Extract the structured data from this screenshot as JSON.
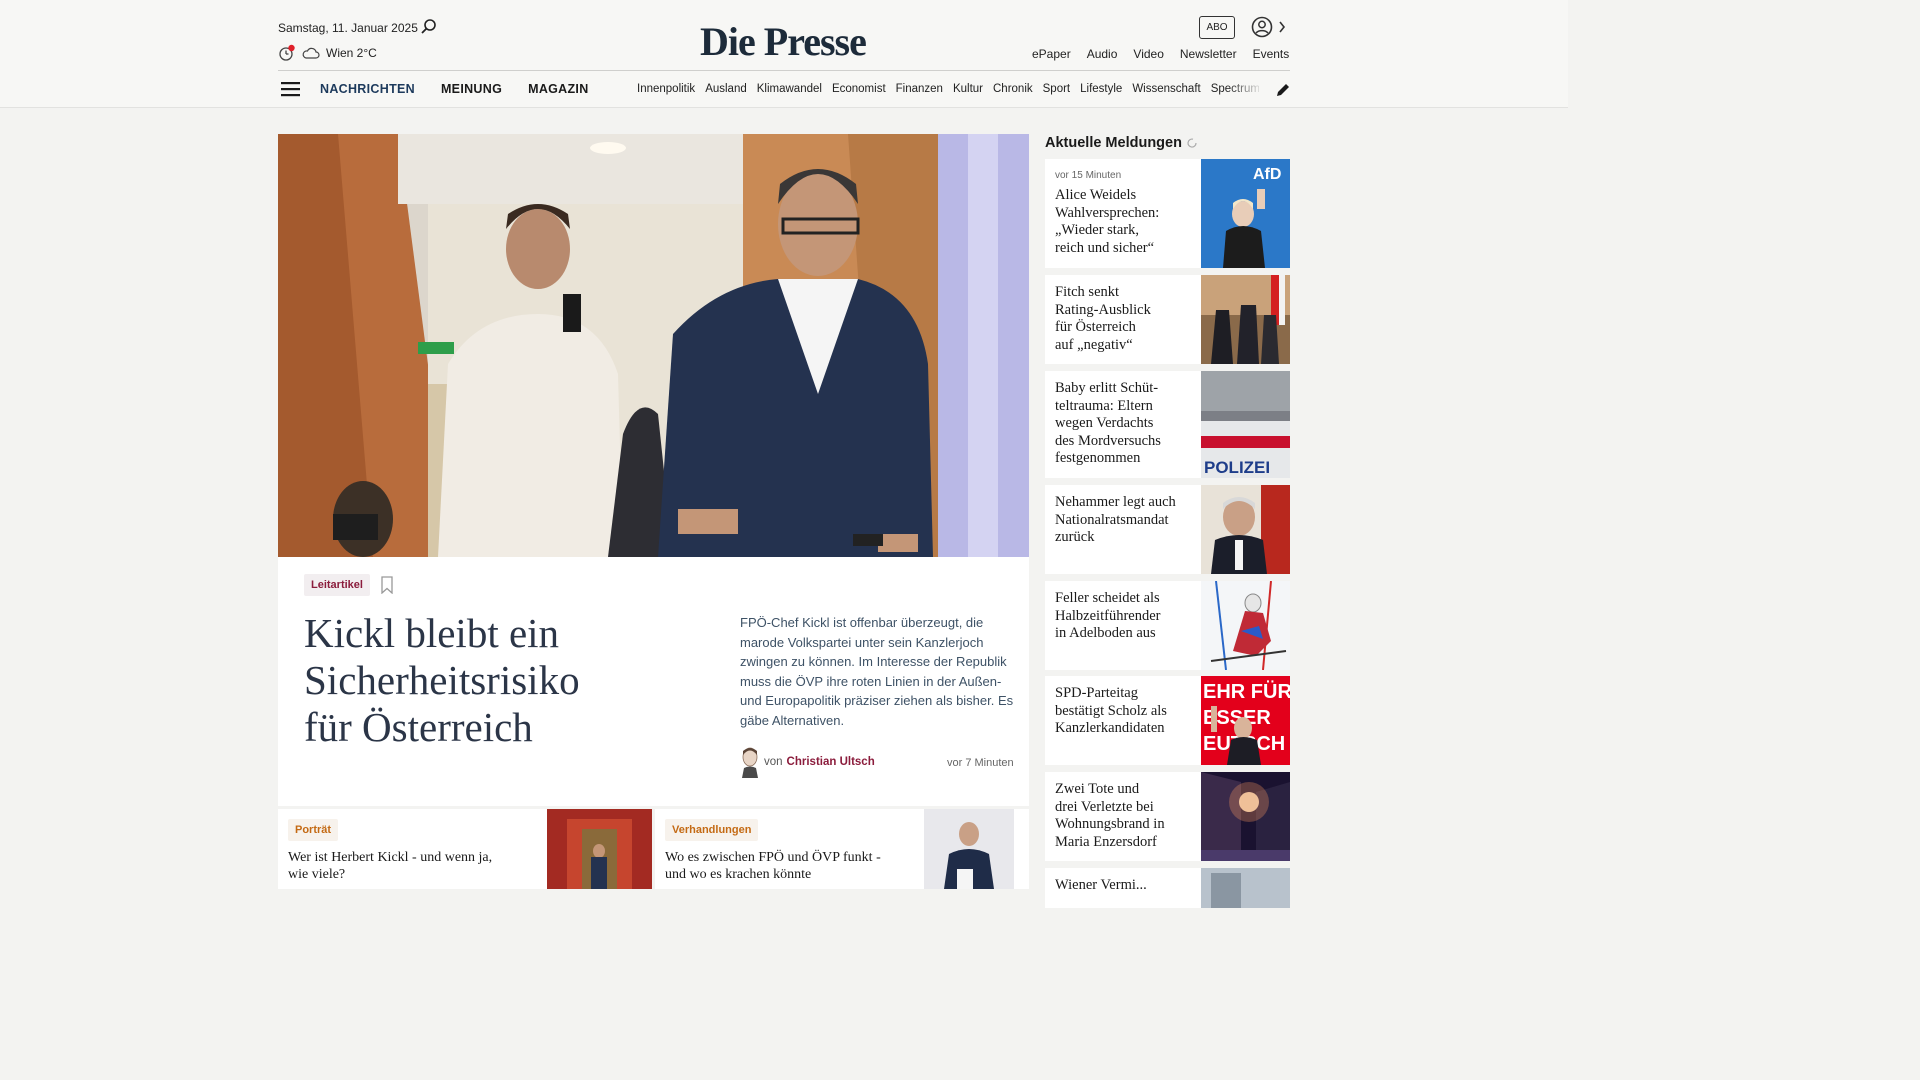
{
  "header": {
    "date": "Samstag, 11. Januar 2025",
    "weather": "Wien 2°C",
    "logo": "Die Presse",
    "abo": "ABO",
    "top_links": [
      "ePaper",
      "Audio",
      "Video",
      "Newsletter",
      "Events"
    ],
    "main_nav": [
      "NACHRICHTEN",
      "MEINUNG",
      "MAGAZIN"
    ],
    "sub_nav": [
      "Innenpolitik",
      "Ausland",
      "Klimawandel",
      "Economist",
      "Finanzen",
      "Kultur",
      "Chronik",
      "Sport",
      "Lifestyle",
      "Wissenschaft",
      "Spectrum"
    ]
  },
  "lead": {
    "tag": "Leitartikel",
    "title_lines": [
      "Kickl bleibt ein",
      "Sicherheitsrisiko",
      "für Österreich"
    ],
    "summary": "FPÖ-Chef Kickl ist offenbar überzeugt, die marode Volkspartei unter sein Kanzlerjoch zwingen zu können. Im Interesse der Republik muss die ÖVP ihre roten Linien in der Außen- und Europapolitik präziser ziehen als bisher. Es gäbe Alternativen.",
    "author_prefix": "von",
    "author": "Christian Ultsch",
    "time": "vor 7 Minuten"
  },
  "cards": [
    {
      "tag": "Porträt",
      "title_lines": [
        "Wer ist Herbert Kickl - und wenn ja,",
        "wie viele?"
      ]
    },
    {
      "tag": "Verhandlungen",
      "title_lines": [
        "Wo es zwischen FPÖ und ÖVP funkt -",
        "und wo es krachen könnte"
      ]
    }
  ],
  "sidebar": {
    "title": "Aktuelle Meldungen",
    "items": [
      {
        "meta": "vor 15 Minuten",
        "title_lines": [
          "Alice Weidels",
          "Wahlversprechen:",
          "„Wieder stark,",
          "reich und sicher“"
        ]
      },
      {
        "meta": "",
        "title_lines": [
          "Fitch senkt",
          "Rating-Ausblick",
          "für Österreich",
          "auf „negativ“"
        ]
      },
      {
        "meta": "",
        "title_lines": [
          "Baby erlitt Schüt-",
          "teltrauma: Eltern",
          "wegen Verdachts",
          "des Mordversuchs",
          "festgenommen"
        ]
      },
      {
        "meta": "",
        "title_lines": [
          "Nehammer legt auch",
          "Nationalratsmandat",
          "zurück"
        ]
      },
      {
        "meta": "",
        "title_lines": [
          "Feller scheidet als",
          "Halbzeitführender",
          "in Adelboden aus"
        ]
      },
      {
        "meta": "",
        "title_lines": [
          "SPD-Parteitag",
          "bestätigt Scholz als",
          "Kanzlerkandidaten"
        ]
      },
      {
        "meta": "",
        "title_lines": [
          "Zwei Tote und",
          "drei Verletzte bei",
          "Wohnungsbrand in",
          "Maria Enzersdorf"
        ]
      },
      {
        "meta": "",
        "title_lines": [
          "Wiener Vermi..."
        ]
      }
    ],
    "image_texts": [
      "AfD",
      "POLIZEI",
      "EHR FÜR",
      "ESSER",
      "EUTSCH"
    ]
  }
}
